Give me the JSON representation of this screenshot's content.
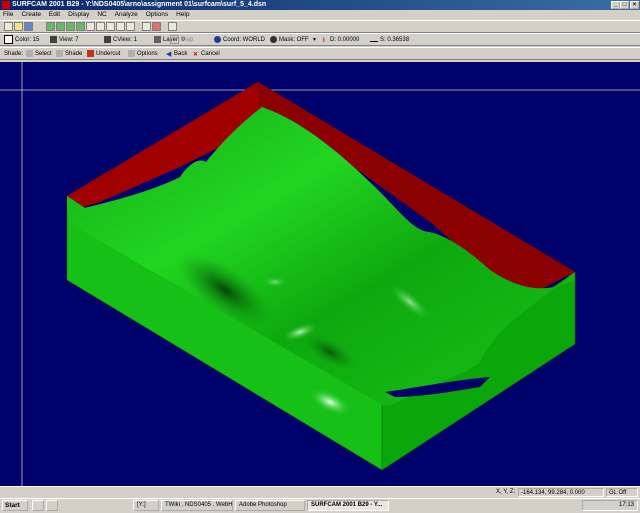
{
  "window": {
    "title": "SURFCAM 2001 B29 - Y:\\NDS0405\\arno\\assignment 01\\surfcam\\surf_5_4.dsn",
    "min": "_",
    "max": "□",
    "close": "×"
  },
  "menu": [
    "File",
    "Create",
    "Edit",
    "Display",
    "NC",
    "Analyze",
    "Options",
    "Help"
  ],
  "toolbar2": {
    "color": "Color: 15",
    "view": "View: 7",
    "cview": "CView: 1",
    "layer": "Layer: 0",
    "trap": "Trap",
    "coord": "Coord: WORLD",
    "mask": "Mask: OFF",
    "d": "D: 0.00000",
    "s": "S: 0.36538"
  },
  "toolbar3": {
    "shade_label": "Shade:",
    "select": "Select",
    "shade": "Shade",
    "undercut": "Undercut",
    "options": "Options",
    "back": "Back",
    "cancel": "Cancel"
  },
  "status": {
    "xyz_label": "X, Y, Z:",
    "coords": "-164.134, 99.284, 0.000",
    "gl": "GL Off"
  },
  "taskbar": {
    "start": "Start",
    "tasks": [
      "",
      "",
      "[Y:]",
      "TWiki . NDS0405 . WebHo...",
      "Adobe Photoshop",
      "SURFCAM 2001 B29 - Y..."
    ],
    "time": "17:13"
  },
  "colors": {
    "background": "#00006b",
    "block_green": "#18c418",
    "red_wall": "#9e0000"
  }
}
